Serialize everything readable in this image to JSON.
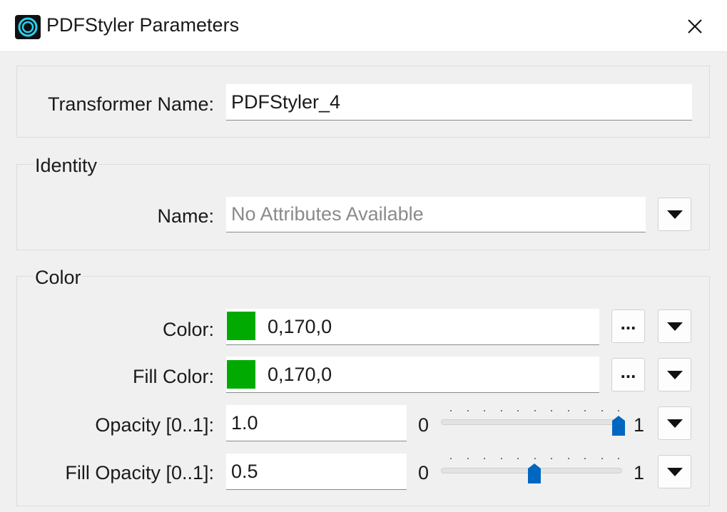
{
  "window": {
    "title": "PDFStyler Parameters"
  },
  "transformer": {
    "label": "Transformer Name:",
    "value": "PDFStyler_4"
  },
  "identity": {
    "title": "Identity",
    "name_label": "Name:",
    "name_placeholder": "No Attributes Available"
  },
  "color_group": {
    "title": "Color",
    "color": {
      "label": "Color:",
      "value": "0,170,0",
      "swatch": "#00aa00"
    },
    "fill_color": {
      "label": "Fill Color:",
      "value": "0,170,0",
      "swatch": "#00aa00"
    },
    "opacity": {
      "label": "Opacity [0..1]:",
      "value": "1.0",
      "min": "0",
      "max": "1",
      "level": 1.0
    },
    "fill_opacity": {
      "label": "Fill Opacity [0..1]:",
      "value": "0.5",
      "min": "0",
      "max": "1",
      "level": 0.5
    },
    "ellipsis_label": "...",
    "dropdown_icon": "triangle-down-icon",
    "accent_color": "#0067c0"
  }
}
